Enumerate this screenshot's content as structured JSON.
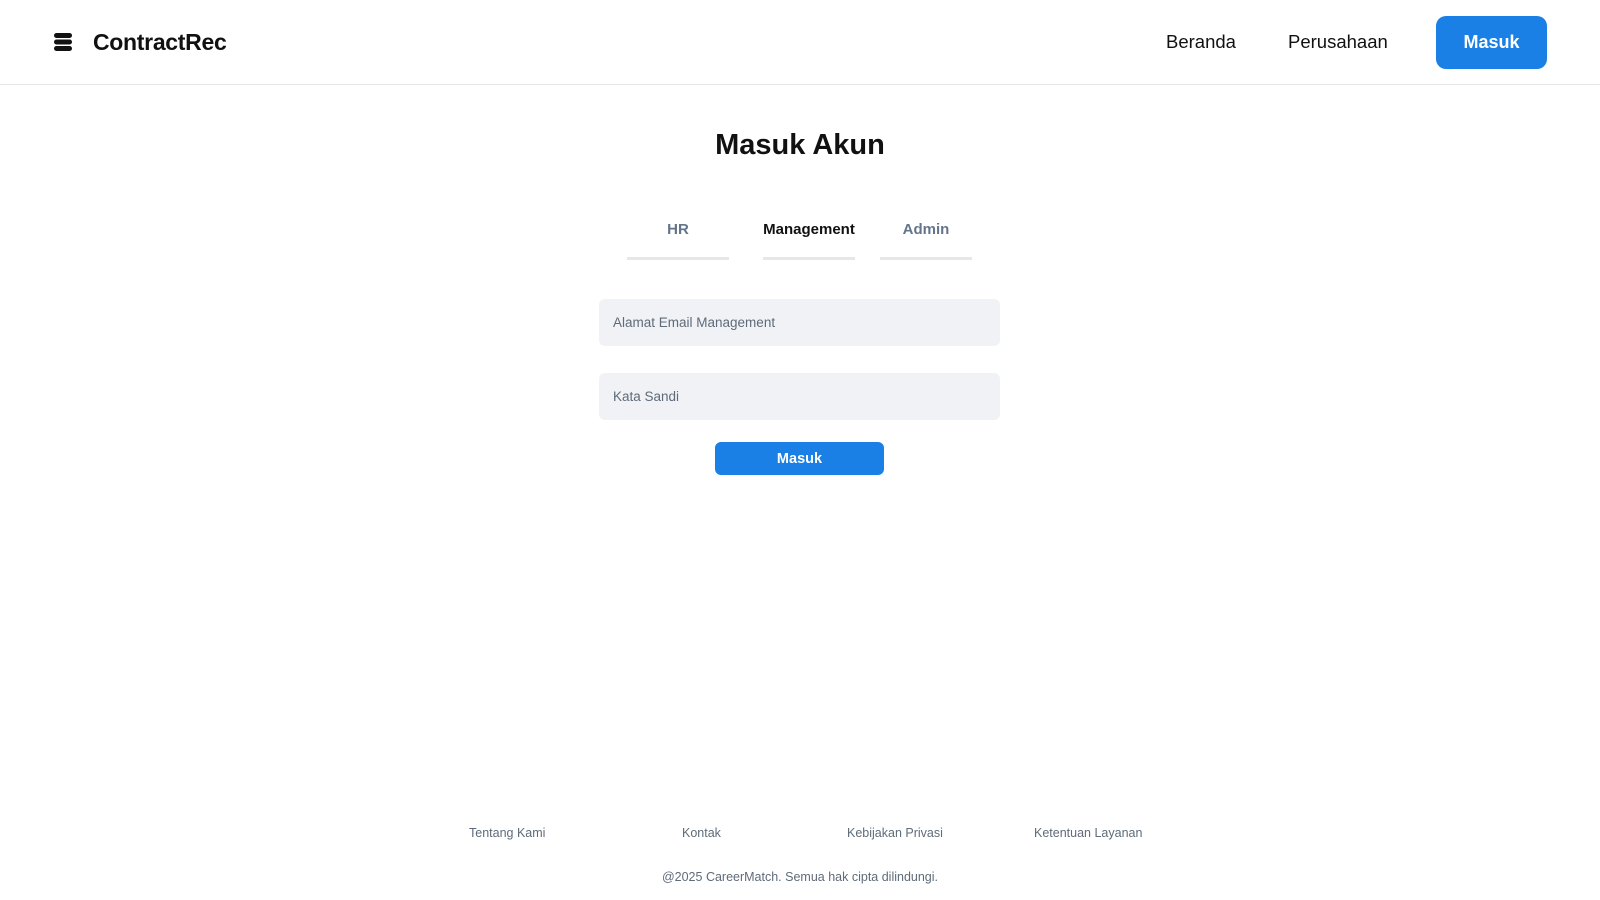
{
  "header": {
    "brand_name": "ContractRec",
    "nav": {
      "home": "Beranda",
      "companies": "Perusahaan",
      "login": "Masuk"
    }
  },
  "main": {
    "title": "Masuk Akun",
    "tabs": [
      {
        "label": "HR",
        "active": false
      },
      {
        "label": "Management",
        "active": true
      },
      {
        "label": "Admin",
        "active": false
      }
    ],
    "form": {
      "email_placeholder": "Alamat Email Management",
      "email_value": "",
      "password_placeholder": "Kata Sandi",
      "password_value": "",
      "submit_label": "Masuk"
    }
  },
  "footer": {
    "links": [
      "Tentang Kami",
      "Kontak",
      "Kebijakan Privasi",
      "Ketentuan Layanan"
    ],
    "copyright": "@2025 CareerMatch. Semua hak cipta dilindungi."
  },
  "colors": {
    "accent": "#1a80e5",
    "input_bg": "#f0f2f5",
    "muted_text": "#5f6b7a",
    "inactive_tab": "#64748b"
  },
  "icons": {
    "brand": "stacked-layers-icon"
  }
}
